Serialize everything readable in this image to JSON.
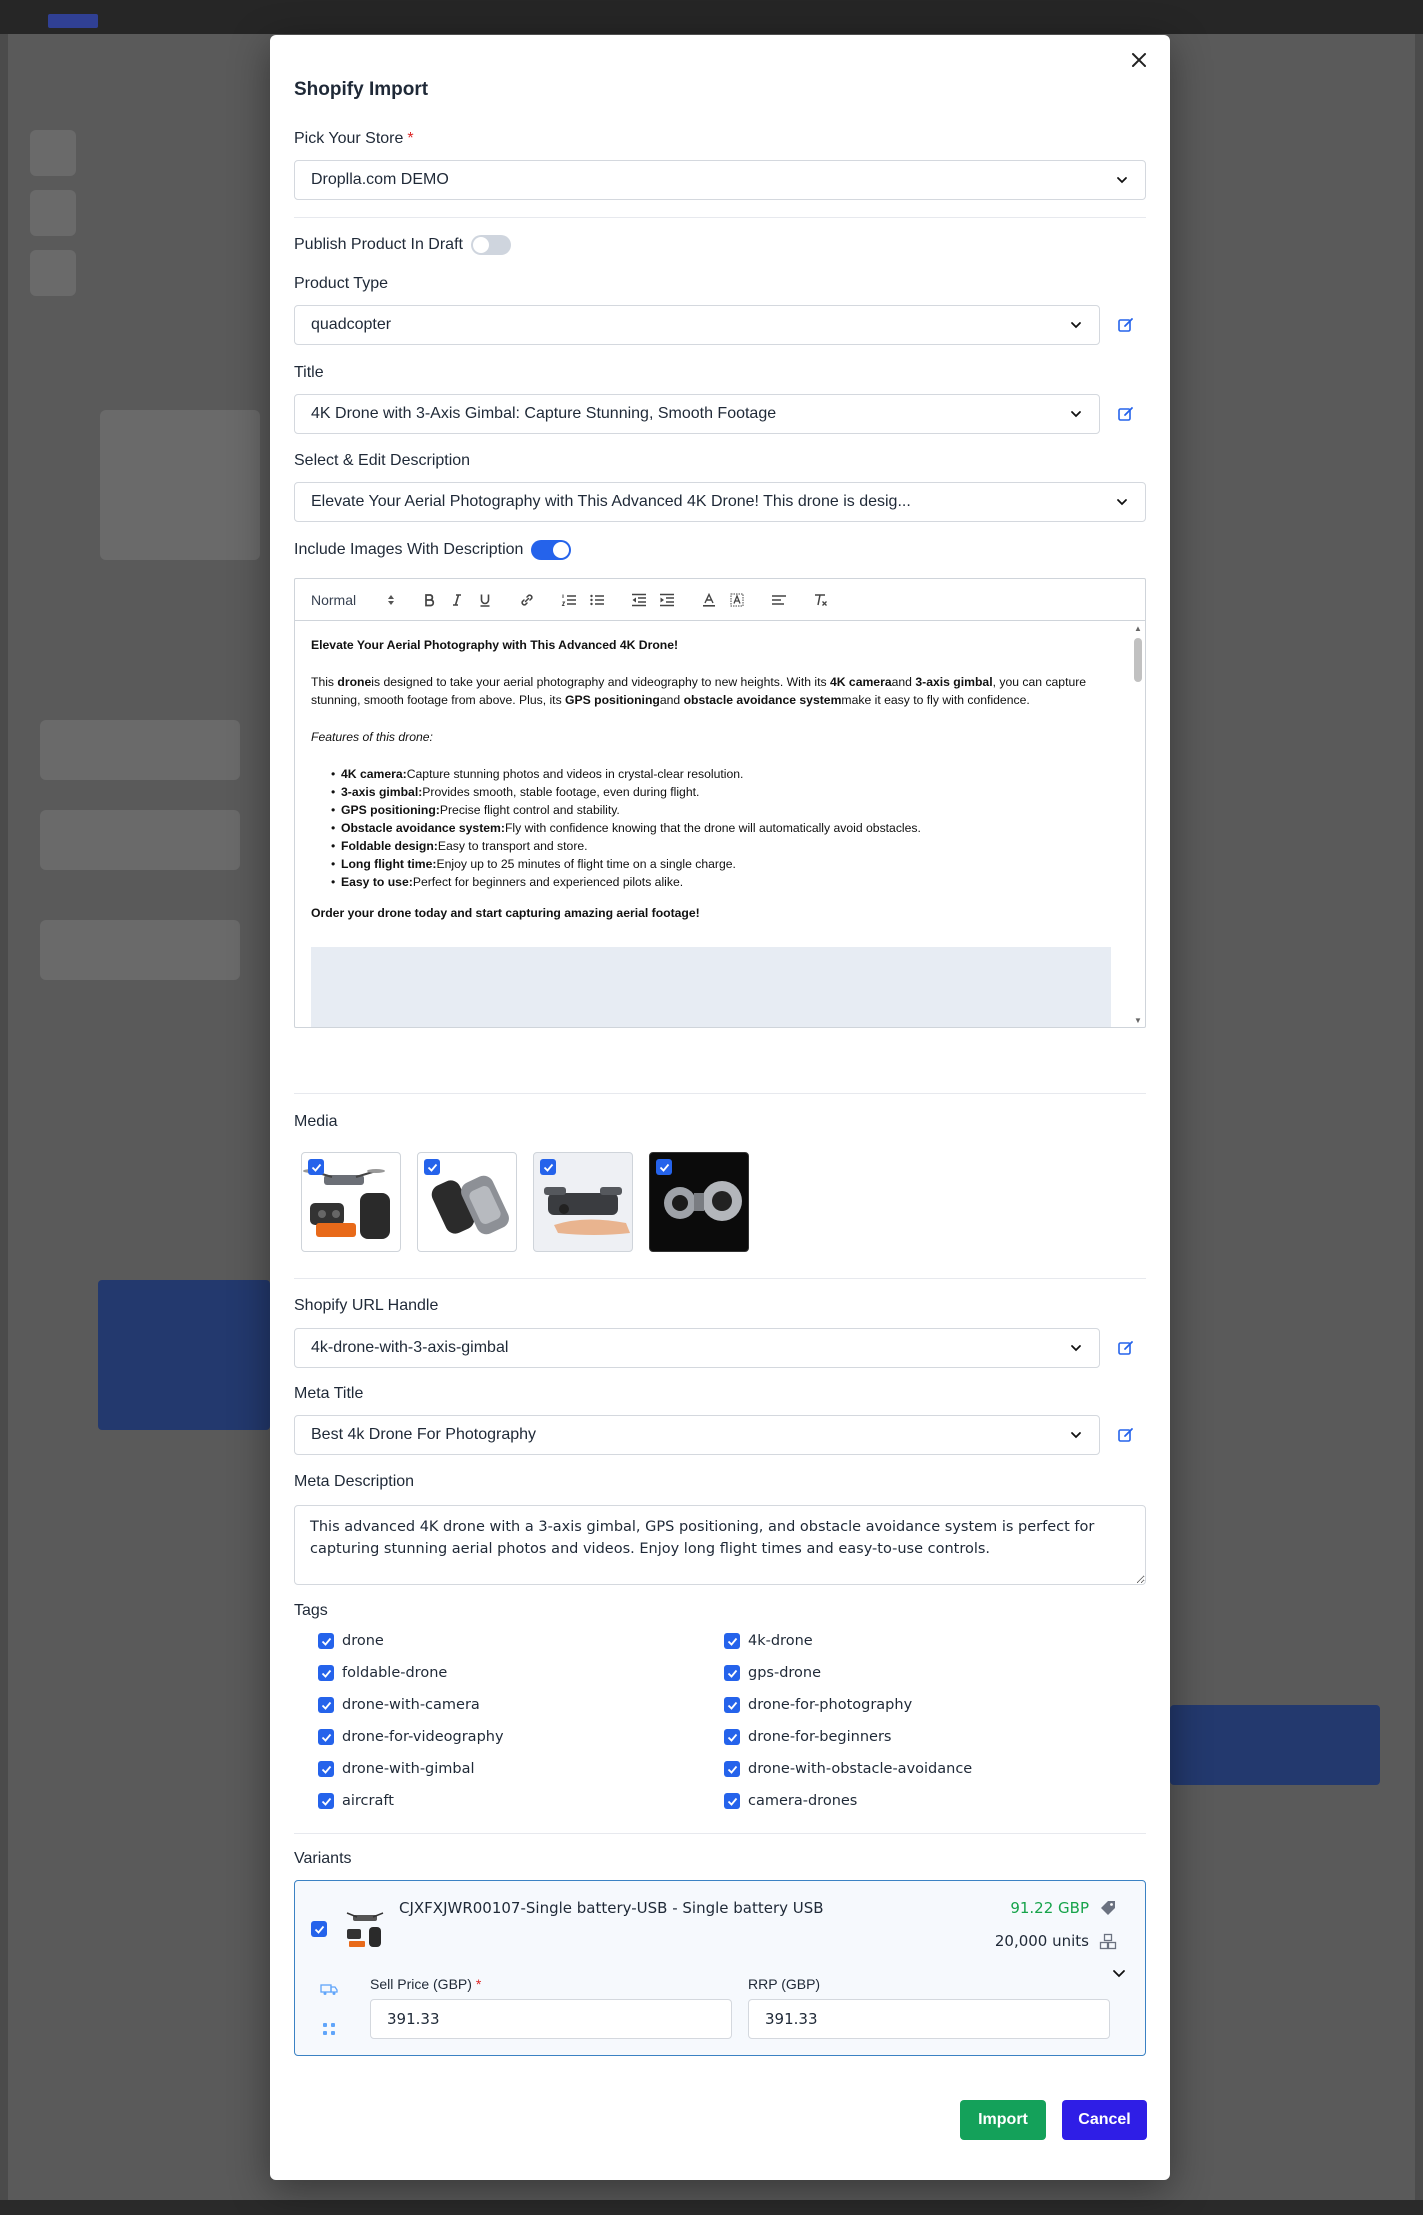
{
  "modal": {
    "title": "Shopify Import",
    "store": {
      "label": "Pick Your Store",
      "value": "Droplla.com DEMO"
    },
    "publish_draft": {
      "label": "Publish Product In Draft",
      "on": false
    },
    "product_type": {
      "label": "Product Type",
      "value": "quadcopter"
    },
    "title_field": {
      "label": "Title",
      "value": "4K Drone with 3-Axis Gimbal: Capture Stunning, Smooth Footage"
    },
    "description_select": {
      "label": "Select & Edit Description",
      "value": "Elevate Your Aerial Photography with This Advanced 4K Drone! This drone is desig..."
    },
    "include_images": {
      "label": "Include Images With Description",
      "on": true
    },
    "editor": {
      "font_size": "Normal",
      "heading": "Elevate Your Aerial Photography with This Advanced 4K Drone!",
      "intro": {
        "t1": "This ",
        "b1": "drone",
        "t2": "is designed to take your aerial photography and videography to new heights. With its ",
        "b2": "4K camera",
        "t3": "and ",
        "b3": "3-axis gimbal",
        "t4": ", you can capture stunning, smooth footage from above. Plus, its ",
        "b4": "GPS positioning",
        "t5": "and ",
        "b5": "obstacle avoidance system",
        "t6": "make it easy to fly with confidence."
      },
      "features_heading": "Features of this drone:",
      "features": [
        {
          "name": "4K camera:",
          "text": "Capture stunning photos and videos in crystal-clear resolution."
        },
        {
          "name": "3-axis gimbal:",
          "text": "Provides smooth, stable footage, even during flight."
        },
        {
          "name": "GPS positioning:",
          "text": "Precise flight control and stability."
        },
        {
          "name": "Obstacle avoidance system:",
          "text": "Fly with confidence knowing that the drone will automatically avoid obstacles."
        },
        {
          "name": "Foldable design:",
          "text": "Easy to transport and store."
        },
        {
          "name": "Long flight time:",
          "text": "Enjoy up to 25 minutes of flight time on a single charge."
        },
        {
          "name": "Easy to use:",
          "text": "Perfect for beginners and experienced pilots alike."
        }
      ],
      "closing": "Order your drone today and start capturing amazing aerial footage!"
    },
    "media": {
      "label": "Media"
    },
    "url_handle": {
      "label": "Shopify URL Handle",
      "value": "4k-drone-with-3-axis-gimbal"
    },
    "meta_title": {
      "label": "Meta Title",
      "value": "Best 4k Drone For Photography"
    },
    "meta_description": {
      "label": "Meta Description",
      "value": "This advanced 4K drone with a 3-axis gimbal, GPS positioning, and obstacle avoidance system is perfect for capturing stunning aerial photos and videos. Enjoy long flight times and easy-to-use controls."
    },
    "tags": {
      "label": "Tags",
      "items": [
        "drone",
        "4k-drone",
        "foldable-drone",
        "gps-drone",
        "drone-with-camera",
        "drone-for-photography",
        "drone-for-videography",
        "drone-for-beginners",
        "drone-with-gimbal",
        "drone-with-obstacle-avoidance",
        "aircraft",
        "camera-drones"
      ]
    },
    "variants": {
      "label": "Variants",
      "item": {
        "name": "CJXFXJWR00107-Single battery-USB - Single battery USB",
        "price": "91.22 GBP",
        "units": "20,000 units",
        "sell_price_label": "Sell Price (GBP)",
        "sell_price": "391.33",
        "rrp_label": "RRP (GBP)",
        "rrp": "391.33"
      }
    },
    "buttons": {
      "import": "Import",
      "cancel": "Cancel"
    }
  },
  "colors": {
    "accent": "#2563eb",
    "import": "#14a15a",
    "cancel": "#2f1ee6",
    "price": "#16a34a"
  }
}
